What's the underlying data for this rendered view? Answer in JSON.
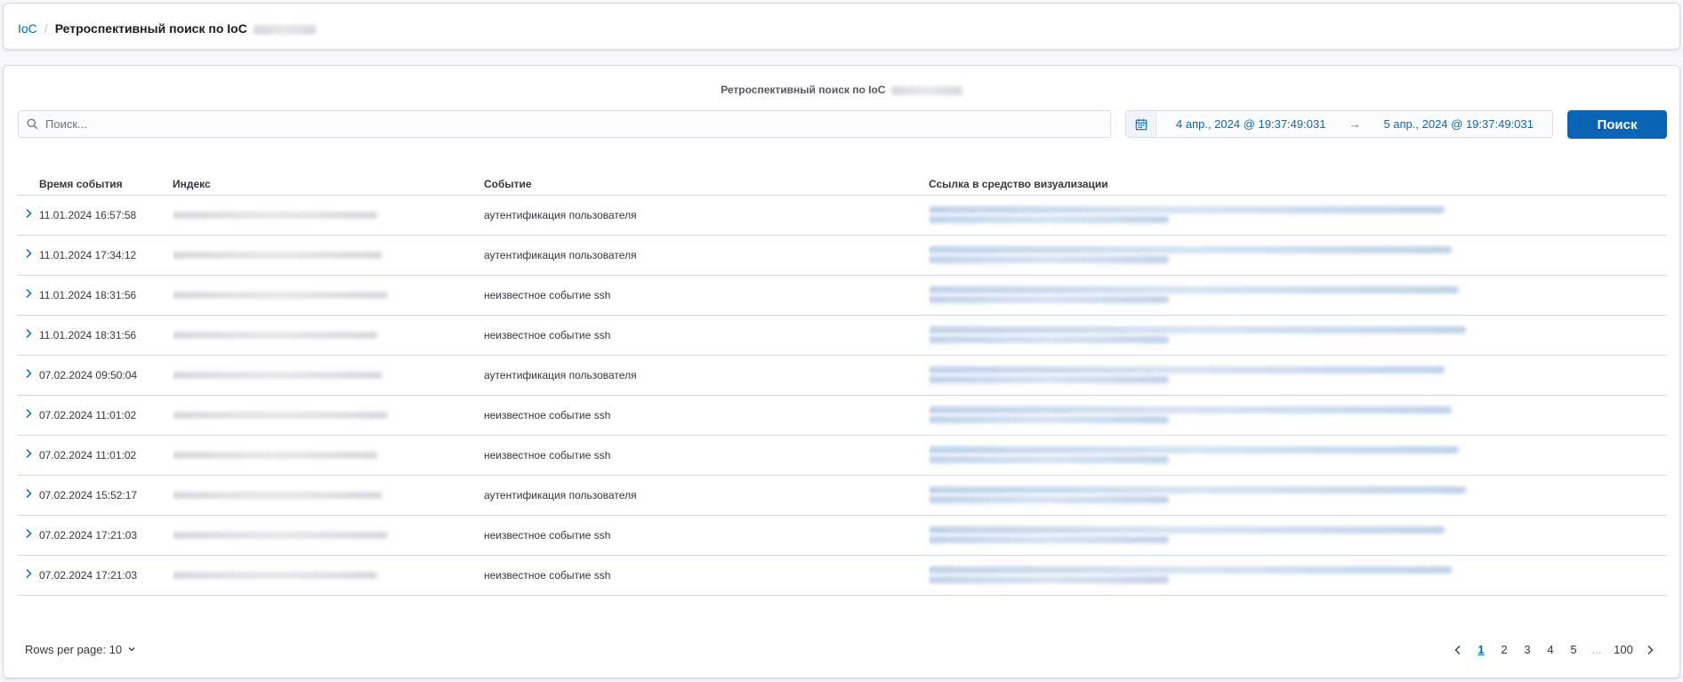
{
  "breadcrumbs": {
    "root": "IoC",
    "separator": "/",
    "current": "Ретроспективный поиск по IoC"
  },
  "main": {
    "title": "Ретроспективный поиск по IoC"
  },
  "search": {
    "placeholder": "Поиск...",
    "value": ""
  },
  "date_range": {
    "start": "4 апр., 2024 @ 19:37:49:031",
    "arrow": "→",
    "end": "5 апр., 2024 @ 19:37:49:031"
  },
  "search_button": "Поиск",
  "table": {
    "columns": [
      "Время события",
      "Индекс",
      "Событие",
      "Ссылка в средство визуализации"
    ],
    "rows": [
      {
        "time": "11.01.2024 16:57:58",
        "event": "аутентификация пользователя"
      },
      {
        "time": "11.01.2024 17:34:12",
        "event": "аутентификация пользователя"
      },
      {
        "time": "11.01.2024 18:31:56",
        "event": "неизвестное событие ssh"
      },
      {
        "time": "11.01.2024 18:31:56",
        "event": "неизвестное событие ssh"
      },
      {
        "time": "07.02.2024 09:50:04",
        "event": "аутентификация пользователя"
      },
      {
        "time": "07.02.2024 11:01:02",
        "event": "неизвестное событие ssh"
      },
      {
        "time": "07.02.2024 11:01:02",
        "event": "неизвестное событие ssh"
      },
      {
        "time": "07.02.2024 15:52:17",
        "event": "аутентификация пользователя"
      },
      {
        "time": "07.02.2024 17:21:03",
        "event": "неизвестное событие ssh"
      },
      {
        "time": "07.02.2024 17:21:03",
        "event": "неизвестное событие ssh"
      }
    ]
  },
  "footer": {
    "rows_per_page": "Rows per page: 10",
    "pages": [
      "1",
      "2",
      "3",
      "4",
      "5",
      "...",
      "100"
    ],
    "active_page": "1"
  },
  "icons": {
    "search": "search-icon",
    "calendar": "calendar-icon",
    "expand": "chevron-right-icon",
    "rows_dropdown": "chevron-down-icon",
    "prev": "chevron-left-icon",
    "next": "chevron-right-icon"
  },
  "colors": {
    "accent": "#006bb8",
    "button": "#0b64b4",
    "border": "#d3dae6"
  }
}
